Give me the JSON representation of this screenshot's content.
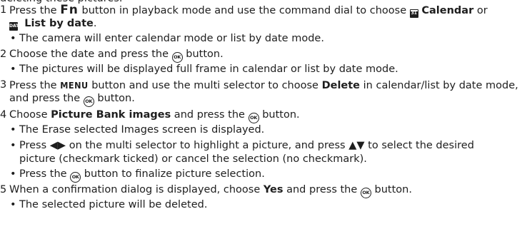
{
  "steps": [
    {
      "num": "1",
      "pre": "Press the ",
      "key": "Fn",
      "mid": " button in playback mode and use the command dial to choose ",
      "icon1": "calendar-icon",
      "calendar": "Calendar",
      "or": " or",
      "icon2": "list-by-date-icon",
      "list": "List by date",
      "end": ".",
      "bullets": [
        "The camera will enter calendar mode or list by date mode."
      ]
    },
    {
      "num": "2",
      "pre": "Choose the date and press the ",
      "post": " button.",
      "bullets": [
        "The pictures will be displayed full frame in calendar or list by date mode."
      ]
    },
    {
      "num": "3",
      "pre": "Press the ",
      "key": "MENU",
      "mid": " button and use the multi selector to choose ",
      "bold": "Delete",
      "post": " in calendar/list by date mode,",
      "cont_pre": "and press the ",
      "cont_post": " button."
    },
    {
      "num": "4",
      "pre": "Choose ",
      "bold": "Picture Bank images",
      "mid": " and press the ",
      "post": " button.",
      "bullets": [
        "The Erase selected Images screen is displayed.",
        "on the multi selector to highlight a picture, and press ",
        "picture (checkmark ticked) or cancel the selection (no checkmark).",
        "Press the "
      ],
      "b2_pre": "Press ",
      "b2_lr": "◀▶",
      "b2_ud": "▲▼",
      "b2_post": " to select the desired",
      "b4_post": " button to finalize picture selection."
    },
    {
      "num": "5",
      "pre": "When a confirmation dialog is displayed, choose ",
      "bold": "Yes",
      "mid": " and press the ",
      "post": " button.",
      "bullets": [
        "The selected picture will be deleted."
      ]
    }
  ],
  "ok_label": "OK",
  "bullet_char": "•"
}
